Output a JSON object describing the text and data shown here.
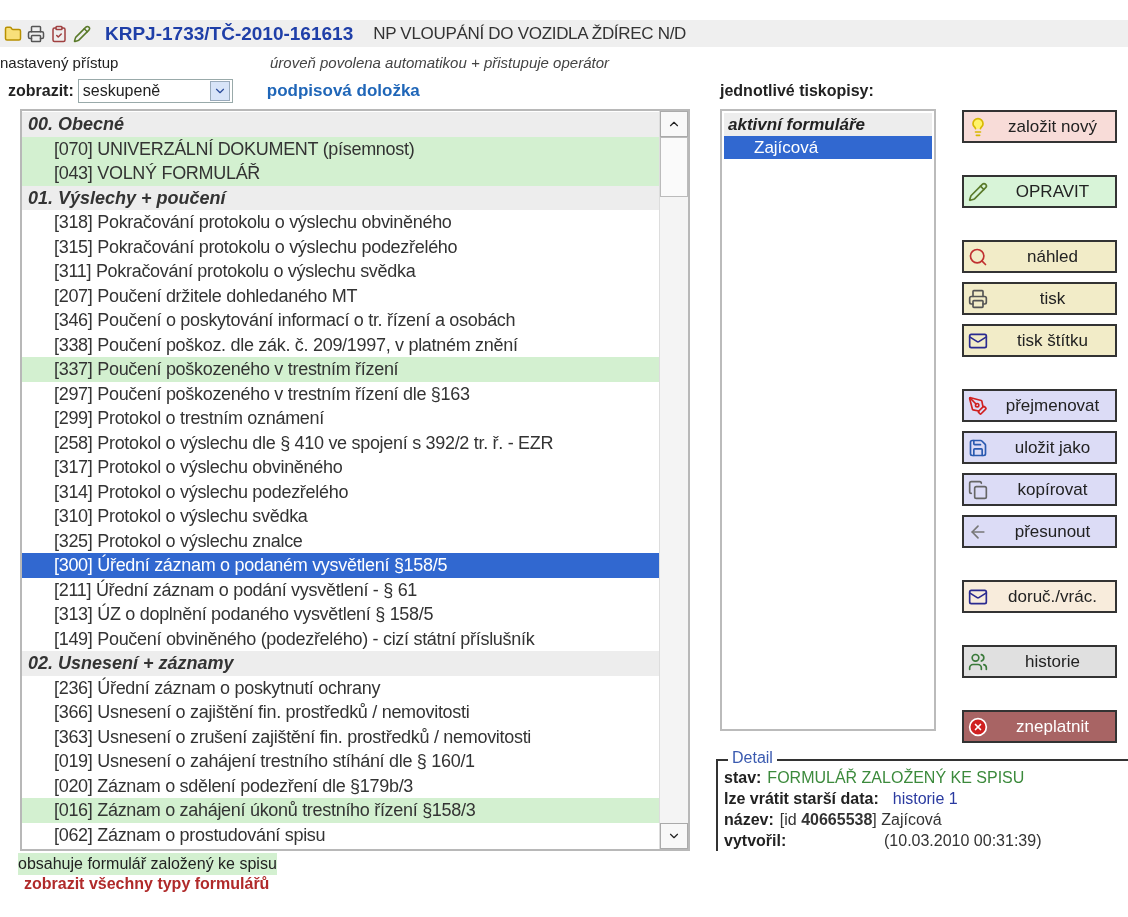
{
  "header": {
    "case_number": "KRPJ-1733/TČ-2010-161613",
    "case_title": "NP VLOUPÁNÍ DO VOZIDLA ŽDÍREC N/D"
  },
  "access": {
    "label": "nastavený přístup",
    "note": "úroveň povolena automatikou + přistupuje operátor"
  },
  "view": {
    "label": "zobrazit:",
    "value": "seskupeně",
    "link": "podpisová doložka"
  },
  "form_list": {
    "groups": [
      {
        "title": "00. Obecné",
        "items": [
          {
            "label": "[070] UNIVERZÁLNÍ DOKUMENT (písemnost)",
            "filed": true,
            "selected": false
          },
          {
            "label": "[043] VOLNÝ FORMULÁŘ",
            "filed": true,
            "selected": false
          }
        ]
      },
      {
        "title": "01. Výslechy + poučení",
        "items": [
          {
            "label": "[318] Pokračování protokolu o výslechu obviněného",
            "filed": false,
            "selected": false
          },
          {
            "label": "[315] Pokračování protokolu o výslechu podezřelého",
            "filed": false,
            "selected": false
          },
          {
            "label": "[311] Pokračování protokolu o výslechu svědka",
            "filed": false,
            "selected": false
          },
          {
            "label": "[207] Poučení držitele dohledaného MT",
            "filed": false,
            "selected": false
          },
          {
            "label": "[346] Poučení o poskytování informací o tr. řízení a osobách",
            "filed": false,
            "selected": false
          },
          {
            "label": "[338] Poučení poškoz. dle zák. č. 209/1997, v platném znění",
            "filed": false,
            "selected": false
          },
          {
            "label": "[337] Poučení poškozeného v trestním řízení",
            "filed": true,
            "selected": false
          },
          {
            "label": "[297] Poučení poškozeného v trestním řízení dle §163",
            "filed": false,
            "selected": false
          },
          {
            "label": "[299] Protokol o trestním oznámení",
            "filed": false,
            "selected": false
          },
          {
            "label": "[258] Protokol o výslechu dle § 410 ve spojení s 392/2 tr. ř. - EZR",
            "filed": false,
            "selected": false
          },
          {
            "label": "[317] Protokol o výslechu obviněného",
            "filed": false,
            "selected": false
          },
          {
            "label": "[314] Protokol o výslechu podezřelého",
            "filed": false,
            "selected": false
          },
          {
            "label": "[310] Protokol o výslechu svědka",
            "filed": false,
            "selected": false
          },
          {
            "label": "[325] Protokol o výslechu znalce",
            "filed": false,
            "selected": false
          },
          {
            "label": "[300] Úřední záznam o podaném vysvětlení §158/5",
            "filed": false,
            "selected": true
          },
          {
            "label": "[211] Úřední záznam o podání vysvětlení - § 61",
            "filed": false,
            "selected": false
          },
          {
            "label": "[313] ÚZ o doplnění podaného vysvětlení § 158/5",
            "filed": false,
            "selected": false
          },
          {
            "label": "[149] Poučení obviněného (podezřelého) - cizí státní příslušník",
            "filed": false,
            "selected": false
          }
        ]
      },
      {
        "title": "02. Usnesení + záznamy",
        "items": [
          {
            "label": "[236] Úřední záznam o poskytnutí ochrany",
            "filed": false,
            "selected": false
          },
          {
            "label": "[366] Usnesení o zajištění fin. prostředků / nemovitosti",
            "filed": false,
            "selected": false
          },
          {
            "label": "[363] Usnesení o zrušení zajištění fin. prostředků / nemovitosti",
            "filed": false,
            "selected": false
          },
          {
            "label": "[019] Usnesení o zahájení trestního stíhání dle § 160/1",
            "filed": false,
            "selected": false
          },
          {
            "label": "[020] Záznam o sdělení podezření dle §179b/3",
            "filed": false,
            "selected": false
          },
          {
            "label": "[016] Záznam o zahájení úkonů trestního řízení §158/3",
            "filed": true,
            "selected": false
          },
          {
            "label": "[062] Záznam o prostudování spisu",
            "filed": false,
            "selected": false
          }
        ]
      }
    ]
  },
  "legend": "obsahuje formulář založený ke spisu",
  "show_all_link": "zobrazit všechny typy formulářů",
  "sheets": {
    "title": "jednotlivé tiskopisy:",
    "list_title": "aktivní formuláře",
    "items": [
      {
        "label": "Zajícová",
        "selected": true
      }
    ]
  },
  "button_groups": [
    [
      {
        "label": "založit nový",
        "color": "#f8dcd8"
      }
    ],
    [
      {
        "label": "OPRAVIT",
        "color": "#d8f4d8"
      }
    ],
    [
      {
        "label": "náhled",
        "color": "#f2ecc8"
      },
      {
        "label": "tisk",
        "color": "#f2ecc8"
      },
      {
        "label": "tisk štítku",
        "color": "#f2ecc8"
      }
    ],
    [
      {
        "label": "přejmenovat",
        "color": "#dcdcf6"
      },
      {
        "label": "uložit jako",
        "color": "#dcdcf6"
      },
      {
        "label": "kopírovat",
        "color": "#dcdcf6"
      },
      {
        "label": "přesunout",
        "color": "#dcdcf6"
      }
    ],
    [
      {
        "label": "doruč./vrác.",
        "color": "#f8ecdc"
      }
    ],
    [
      {
        "label": "historie",
        "color": "#e0e0e0"
      }
    ],
    [
      {
        "label": "zneplatnit",
        "color": "#a86464"
      }
    ]
  ],
  "detail": {
    "legend": "Detail",
    "rows": [
      {
        "label": "stav:",
        "value": "FORMULÁŘ ZALOŽENÝ KE SPISU",
        "kind": "status"
      },
      {
        "label": "lze vrátit starší data:",
        "value": "historie 1",
        "kind": "link"
      },
      {
        "label": "název:",
        "value": "[id **40665538**] Zajícová",
        "kind": "text"
      },
      {
        "label": "vytvořil:",
        "value": "(10.03.2010 00:31:39)",
        "kind": "date"
      }
    ]
  }
}
